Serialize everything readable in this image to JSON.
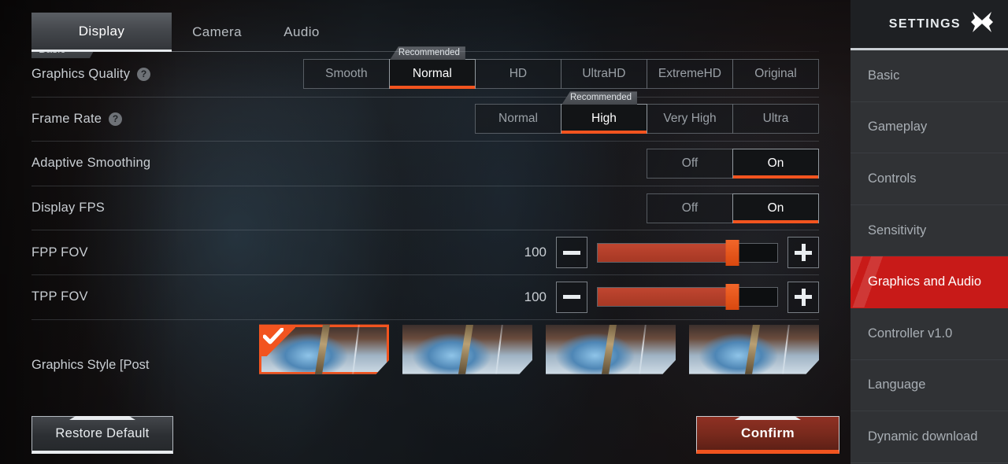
{
  "tabs": [
    {
      "label": "Display",
      "active": true
    },
    {
      "label": "Camera",
      "active": false
    },
    {
      "label": "Audio",
      "active": false
    }
  ],
  "section_chip": "Basic",
  "rows": {
    "graphics_quality": {
      "label": "Graphics Quality",
      "help_icon": "question-mark-icon",
      "options": [
        "Smooth",
        "Normal",
        "HD",
        "UltraHD",
        "ExtremeHD",
        "Original"
      ],
      "selected": "Normal",
      "recommended": "Recommended",
      "recommended_for": "Normal"
    },
    "frame_rate": {
      "label": "Frame Rate",
      "help_icon": "question-mark-icon",
      "options": [
        "Normal",
        "High",
        "Very High",
        "Ultra"
      ],
      "selected": "High",
      "recommended": "Recommended",
      "recommended_for": "High"
    },
    "adaptive_smoothing": {
      "label": "Adaptive Smoothing",
      "options": [
        "Off",
        "On"
      ],
      "selected": "On"
    },
    "display_fps": {
      "label": "Display FPS",
      "options": [
        "Off",
        "On"
      ],
      "selected": "On"
    },
    "fpp_fov": {
      "label": "FPP FOV",
      "value": "100",
      "fill_percent": 75,
      "minus_label": "−",
      "plus_label": "+"
    },
    "tpp_fov": {
      "label": "TPP FOV",
      "value": "100",
      "fill_percent": 75,
      "minus_label": "−",
      "plus_label": "+"
    },
    "graphics_style": {
      "label": "Graphics Style [Post",
      "thumbnails": [
        {
          "selected": true
        },
        {
          "selected": false
        },
        {
          "selected": false
        },
        {
          "selected": false
        }
      ],
      "check_icon": "checkmark-icon"
    }
  },
  "footer": {
    "restore_default": "Restore Default",
    "confirm": "Confirm"
  },
  "sidebar": {
    "title": "SETTINGS",
    "close_icon": "close-x-icon",
    "items": [
      {
        "label": "Basic",
        "active": false
      },
      {
        "label": "Gameplay",
        "active": false
      },
      {
        "label": "Controls",
        "active": false
      },
      {
        "label": "Sensitivity",
        "active": false
      },
      {
        "label": "Graphics and Audio",
        "active": true
      },
      {
        "label": "Controller v1.0",
        "active": false
      },
      {
        "label": "Language",
        "active": false
      },
      {
        "label": "Dynamic download",
        "active": false
      }
    ]
  },
  "colors": {
    "accent_orange": "#f2541f",
    "accent_red": "#c81a18",
    "slider_fill": "#b53a28",
    "panel_dark": "#303235"
  }
}
